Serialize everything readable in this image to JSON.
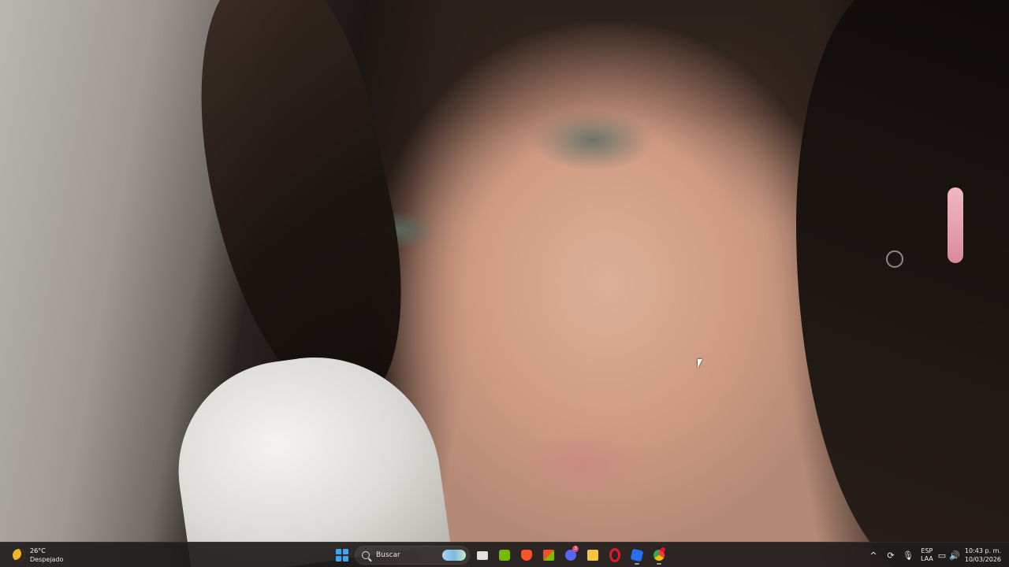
{
  "weather": {
    "temperature": "26°C",
    "condition": "Despejado",
    "icon": "moon-icon"
  },
  "taskbar": {
    "search_label": "Buscar",
    "apps": [
      {
        "name": "task-view",
        "icon": "taskview-icon"
      },
      {
        "name": "nvidia",
        "icon": "nvidia-icon"
      },
      {
        "name": "brave",
        "icon": "brave-icon"
      },
      {
        "name": "microsoft-store",
        "icon": "store-icon"
      },
      {
        "name": "discord",
        "icon": "discord-icon",
        "badge": "3"
      },
      {
        "name": "file-explorer",
        "icon": "explorer-icon"
      },
      {
        "name": "opera",
        "icon": "opera-icon"
      },
      {
        "name": "roblox",
        "icon": "roblox-icon"
      },
      {
        "name": "chrome",
        "icon": "chrome-icon"
      }
    ]
  },
  "tray": {
    "language_top": "ESP",
    "language_bottom": "LAA",
    "time": "10:43 p. m.",
    "date": "10/03/2026",
    "chevron": "^"
  },
  "colors": {
    "taskbar_bg": "#201c1c",
    "windows_blue": "#3da5f4",
    "weather_accent": "#f0b429"
  }
}
